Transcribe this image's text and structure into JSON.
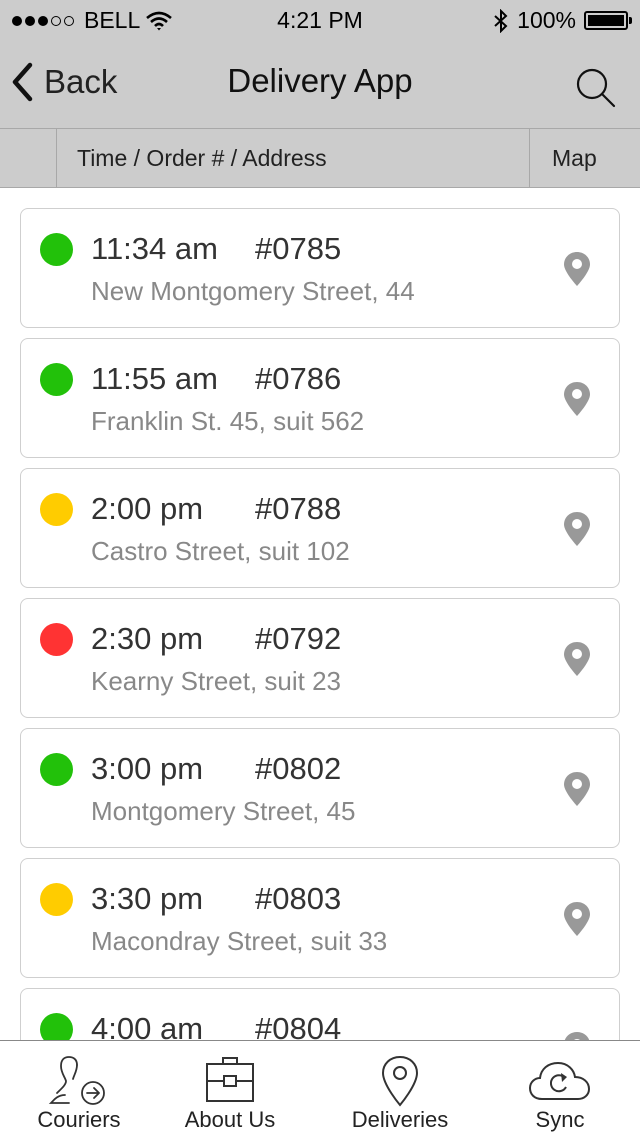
{
  "status_bar": {
    "carrier": "BELL",
    "signal_filled": 3,
    "signal_total": 5,
    "time": "4:21 PM",
    "battery": "100%",
    "battery_level": 1.0
  },
  "nav": {
    "back_label": "Back",
    "title": "Delivery App",
    "search_icon": "search-icon"
  },
  "columns": {
    "main": "Time / Order # / Address",
    "map": "Map"
  },
  "status_colors": {
    "green": "#22c10a",
    "yellow": "#ffcc00",
    "red": "#ff3333"
  },
  "deliveries": [
    {
      "time": "11:34 am",
      "order": "#0785",
      "address": "New Montgomery Street, 44",
      "status": "green"
    },
    {
      "time": "11:55 am",
      "order": "#0786",
      "address": "Franklin St. 45, suit 562",
      "status": "green"
    },
    {
      "time": "2:00 pm",
      "order": "#0788",
      "address": "Castro Street, suit 102",
      "status": "yellow"
    },
    {
      "time": "2:30 pm",
      "order": "#0792",
      "address": "Kearny Street, suit 23",
      "status": "red"
    },
    {
      "time": "3:00 pm",
      "order": "#0802",
      "address": "Montgomery Street, 45",
      "status": "green"
    },
    {
      "time": "3:30 pm",
      "order": "#0803",
      "address": "Macondray Street, suit 33",
      "status": "yellow"
    },
    {
      "time": "4:00 am",
      "order": "#0804",
      "address": "",
      "status": "green"
    }
  ],
  "tabs": [
    {
      "label": "Couriers",
      "icon": "courier-icon"
    },
    {
      "label": "About Us",
      "icon": "briefcase-icon"
    },
    {
      "label": "Deliveries",
      "icon": "location-pin-icon"
    },
    {
      "label": "Sync",
      "icon": "cloud-sync-icon"
    }
  ]
}
